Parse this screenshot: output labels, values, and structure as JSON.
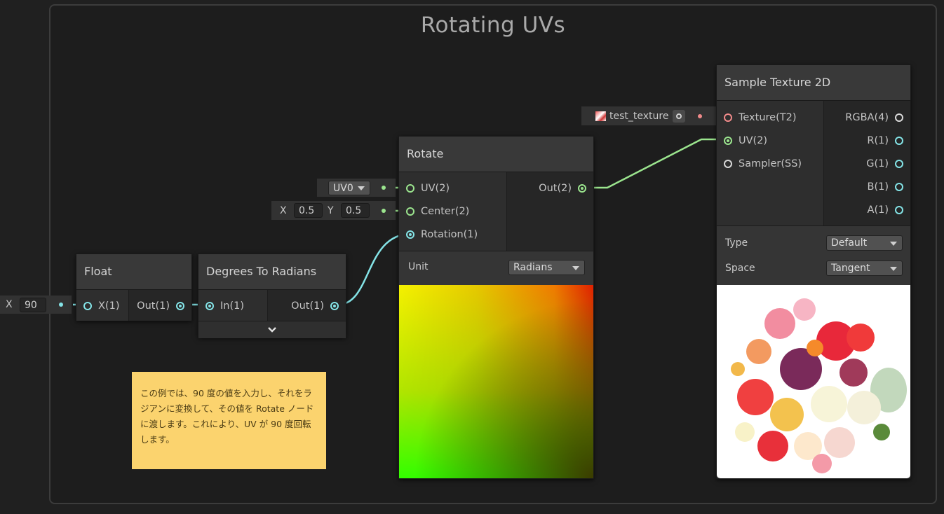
{
  "group": {
    "title": "Rotating UVs"
  },
  "float_node": {
    "title": "Float",
    "inputs": [
      "X(1)"
    ],
    "outputs": [
      "Out(1)"
    ],
    "field_label": "X",
    "field_value": "90"
  },
  "deg_node": {
    "title": "Degrees To Radians",
    "inputs": [
      "In(1)"
    ],
    "outputs": [
      "Out(1)"
    ],
    "expand_icon": "chevron-down-icon"
  },
  "rotate_node": {
    "title": "Rotate",
    "inputs": [
      "UV(2)",
      "Center(2)",
      "Rotation(1)"
    ],
    "outputs": [
      "Out(2)"
    ],
    "uv_dropdown": "UV0",
    "center_x_label": "X",
    "center_x": "0.5",
    "center_y_label": "Y",
    "center_y": "0.5",
    "unit_label": "Unit",
    "unit_value": "Radians"
  },
  "sample_node": {
    "title": "Sample Texture 2D",
    "inputs": [
      "Texture(T2)",
      "UV(2)",
      "Sampler(SS)"
    ],
    "outputs": [
      "RGBA(4)",
      "R(1)",
      "G(1)",
      "B(1)",
      "A(1)"
    ],
    "texture_field": "test_texture",
    "type_label": "Type",
    "type_value": "Default",
    "space_label": "Space",
    "space_value": "Tangent"
  },
  "sticky_note": {
    "text": "この例では、90 度の値を入力し、それをラジアンに変換して、その値を Rotate ノードに渡します。これにより、UV が 90 度回転します。"
  },
  "colors": {
    "vec2_wire": "#9be58e",
    "float_wire": "#84e4e7",
    "texture_port": "#f08a8a",
    "sticky": "#fbd36e"
  }
}
